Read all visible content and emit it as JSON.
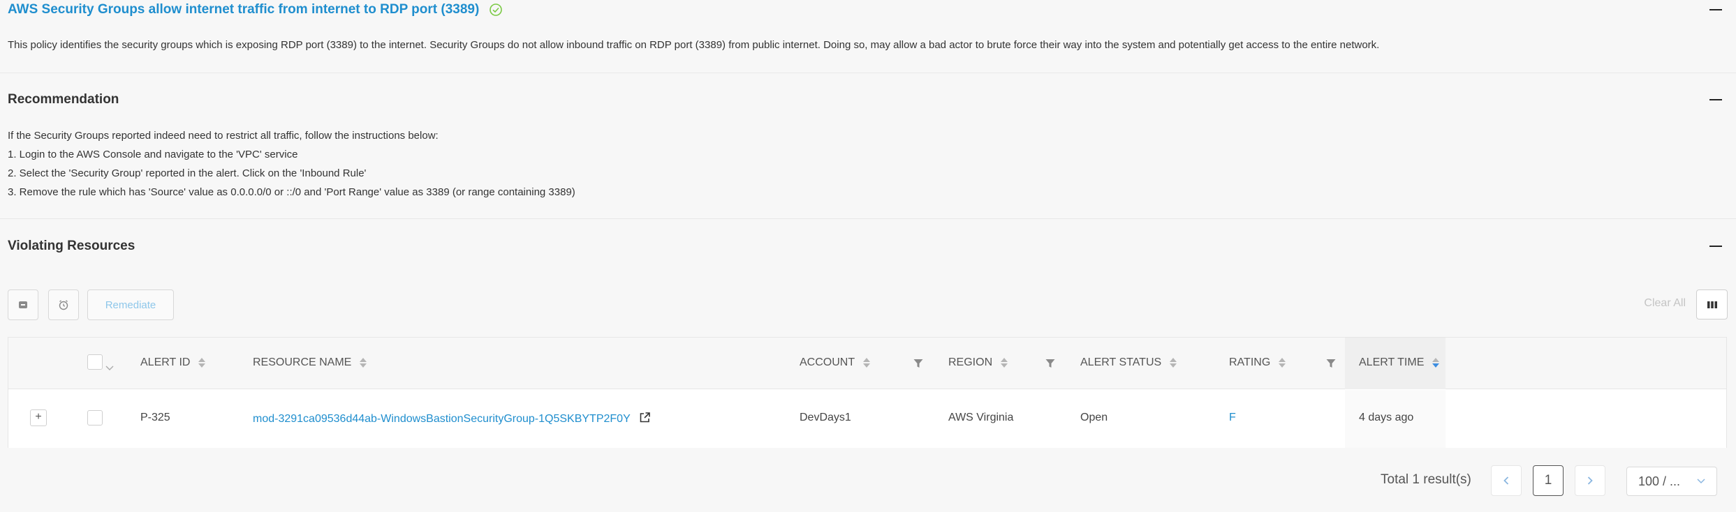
{
  "policy": {
    "title": "AWS Security Groups allow internet traffic from internet to RDP port (3389)",
    "description": "This policy identifies the security groups which is exposing RDP port (3389) to the internet. Security Groups do not allow inbound traffic on RDP port (3389) from public internet. Doing so, may allow a bad actor to brute force their way into the system and potentially get access to the entire network."
  },
  "recommendation": {
    "heading": "Recommendation",
    "lines": [
      "If the Security Groups reported indeed need to restrict all traffic, follow the instructions below:",
      "1. Login to the AWS Console and navigate to the 'VPC' service",
      "2. Select the 'Security Group' reported in the alert. Click on the 'Inbound Rule'",
      "3. Remove the rule which has 'Source' value as 0.0.0.0/0 or ::/0 and 'Port Range' value as 3389 (or range containing 3389)"
    ]
  },
  "violating": {
    "heading": "Violating Resources",
    "remediate_label": "Remediate",
    "clear_all_label": "Clear All",
    "columns": {
      "alert_id": "ALERT ID",
      "resource_name": "RESOURCE NAME",
      "account": "ACCOUNT",
      "region": "REGION",
      "alert_status": "ALERT STATUS",
      "rating": "RATING",
      "alert_time": "ALERT TIME"
    },
    "rows": [
      {
        "alert_id": "P-325",
        "resource_name": "mod-3291ca09536d44ab-WindowsBastionSecurityGroup-1Q5SKBYTP2F0Y",
        "account": "DevDays1",
        "region": "AWS Virginia",
        "alert_status": "Open",
        "rating": "F",
        "alert_time": "4 days ago"
      }
    ],
    "expand_label": "+"
  },
  "pagination": {
    "total": "Total 1 result(s)",
    "current_page": "1",
    "page_size": "100 / ..."
  },
  "colors": {
    "accent": "#1f8ece",
    "success": "#7ac943"
  },
  "icons": {
    "title_status": "check-circle-icon",
    "archive": "archive-icon",
    "snooze": "alarm-clock-icon",
    "columns": "columns-icon",
    "filter": "filter-icon",
    "external": "external-link-icon",
    "prev": "chevron-left-icon",
    "next": "chevron-right-icon",
    "dropdown": "chevron-down-icon"
  }
}
